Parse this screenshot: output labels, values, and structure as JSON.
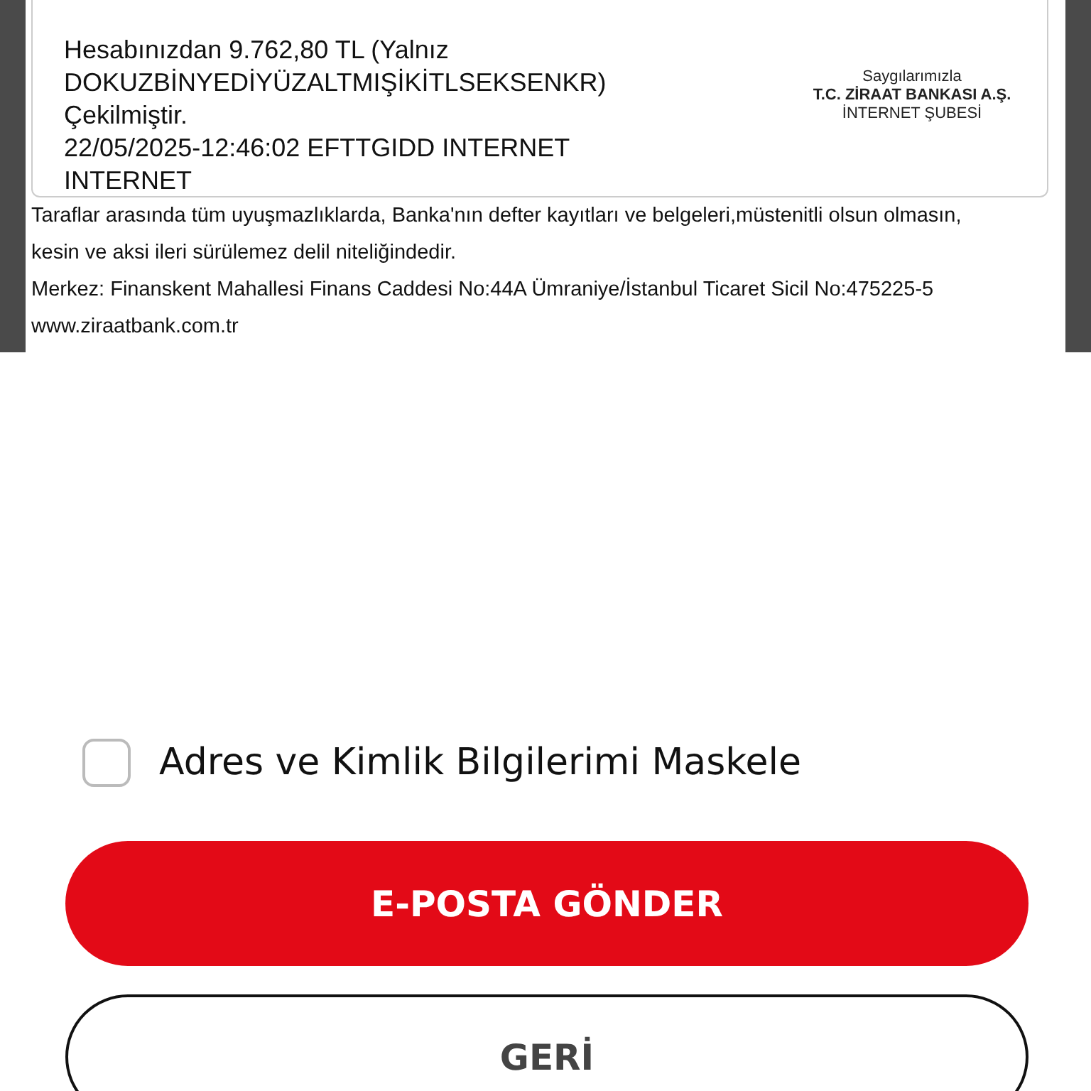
{
  "receipt": {
    "message_lines": [
      "Hesabınızdan 9.762,80 TL (Yalnız",
      "DOKUZBİNYEDİYÜZALTMIŞİKİTLSEKSENKR)",
      "Çekilmiştir.",
      "22/05/2025-12:46:02 EFTTGIDD INTERNET",
      "INTERNET"
    ],
    "signature": {
      "greeting": "Saygılarımızla",
      "bank": "T.C. ZİRAAT BANKASI A.Ş.",
      "branch": "İNTERNET ŞUBESİ"
    }
  },
  "footer_lines": [
    "Taraflar arasında tüm uyuşmazlıklarda, Banka'nın defter kayıtları ve belgeleri,müstenitli olsun olmasın,",
    "kesin ve aksi ileri sürülemez delil niteliğindedir.",
    "Merkez: Finanskent Mahallesi Finans Caddesi No:44A Ümraniye/İstanbul Ticaret Sicil No:475225-5",
    "www.ziraatbank.com.tr"
  ],
  "mask_option": {
    "label": "Adres ve Kimlik Bilgilerimi Maskele",
    "checked": false
  },
  "buttons": [
    {
      "label": "E-POSTA GÖNDER",
      "kind": "primary"
    },
    {
      "label": "GERİ",
      "kind": "secondary"
    }
  ]
}
